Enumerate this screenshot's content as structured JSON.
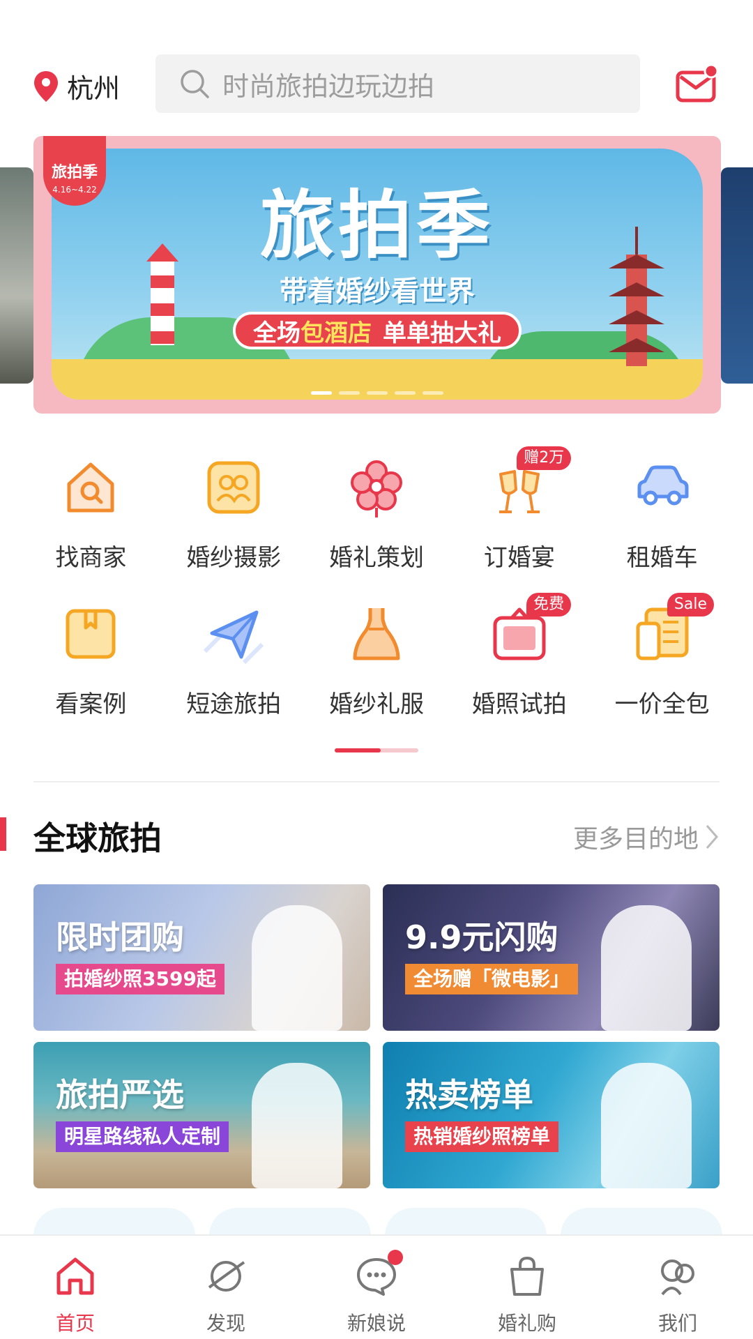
{
  "header": {
    "city": "杭州",
    "search_placeholder": "时尚旅拍边玩边拍",
    "icons": {
      "location": "location-pin-icon",
      "search": "search-icon",
      "message": "mail-icon"
    },
    "message_badge": true
  },
  "banner": {
    "badge": "旅拍季",
    "badge_date": "4.16~4.22",
    "title": "旅拍季",
    "subtitle": "带着婚纱看世界",
    "pill_highlight_pre": "全场",
    "pill_highlight": "包酒店",
    "pill_rest": "单单抽大礼",
    "slide_count": 5,
    "active_slide": 1
  },
  "categories": [
    {
      "label": "找商家",
      "icon": "shop-search-icon"
    },
    {
      "label": "婚纱摄影",
      "icon": "photo-people-icon"
    },
    {
      "label": "婚礼策划",
      "icon": "flower-icon"
    },
    {
      "label": "订婚宴",
      "icon": "toast-glasses-icon",
      "tag": "赠2万"
    },
    {
      "label": "租婚车",
      "icon": "car-icon"
    },
    {
      "label": "看案例",
      "icon": "bookmark-box-icon"
    },
    {
      "label": "短途旅拍",
      "icon": "paper-plane-icon"
    },
    {
      "label": "婚纱礼服",
      "icon": "dress-icon"
    },
    {
      "label": "婚照试拍",
      "icon": "photo-frame-icon",
      "tag": "免费"
    },
    {
      "label": "一价全包",
      "icon": "package-list-icon",
      "tag": "Sale"
    }
  ],
  "section": {
    "title": "全球旅拍",
    "more": "更多目的地"
  },
  "cards": [
    {
      "title": "限时团购",
      "subtitle": "拍婚纱照3599起"
    },
    {
      "title": "9.9元闪购",
      "subtitle": "全场赠「微电影」"
    },
    {
      "title": "旅拍严选",
      "subtitle": "明星路线私人定制"
    },
    {
      "title": "热卖榜单",
      "subtitle": "热销婚纱照榜单"
    }
  ],
  "tabs": [
    {
      "label": "首页",
      "icon": "home-icon",
      "active": true
    },
    {
      "label": "发现",
      "icon": "planet-icon",
      "active": false
    },
    {
      "label": "新娘说",
      "icon": "chat-bubble-icon",
      "active": false,
      "badge": true
    },
    {
      "label": "婚礼购",
      "icon": "shopping-bag-icon",
      "active": false
    },
    {
      "label": "我们",
      "icon": "couple-icon",
      "active": false
    }
  ],
  "colors": {
    "accent": "#e8364a",
    "icon_orange": "#f28a2e",
    "icon_blue": "#5b8ff0"
  }
}
